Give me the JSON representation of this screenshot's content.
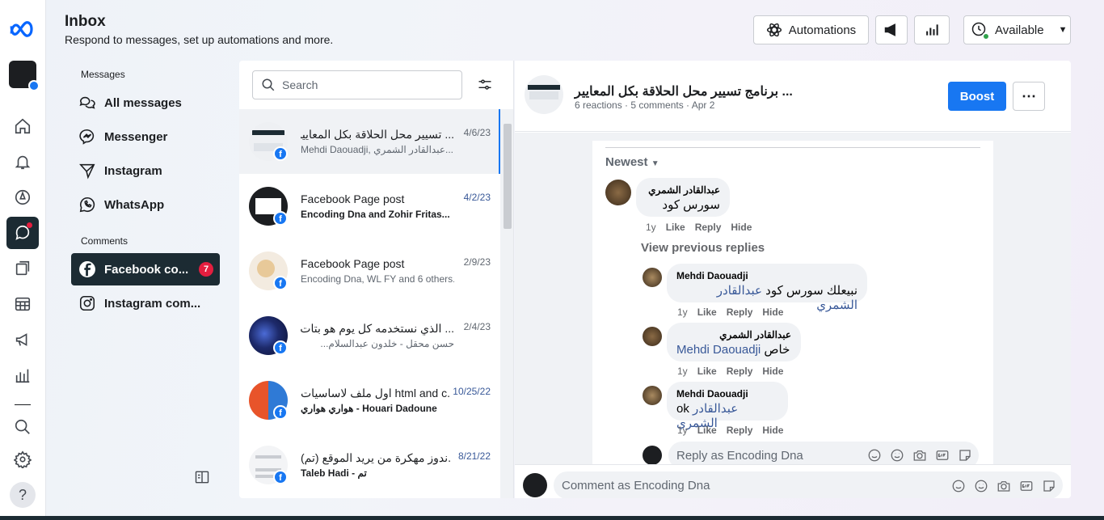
{
  "header": {
    "title": "Inbox",
    "subtitle": "Respond to messages, set up automations and more."
  },
  "top_buttons": {
    "automations": "Automations",
    "status": "Available"
  },
  "nav": {
    "messages_section": "Messages",
    "items": [
      "All messages",
      "Messenger",
      "Instagram",
      "WhatsApp"
    ],
    "comments_section": "Comments",
    "comments": [
      {
        "label": "Facebook co...",
        "badge": "7"
      },
      {
        "label": "Instagram com..."
      }
    ]
  },
  "search": {
    "placeholder": "Search"
  },
  "conversations": [
    {
      "title": "... تسيير محل الحلاقة بكل المعايير",
      "sub": "Mehdi Daouadji, عبدالقادر الشمري...",
      "date": "4/6/23"
    },
    {
      "title": "Facebook Page post",
      "sub": "Encoding Dna and Zohir Fritas...",
      "date": "4/2/23"
    },
    {
      "title": "Facebook Page post",
      "sub": "Encoding Dna, WL FY and 6 others...",
      "date": "2/9/23"
    },
    {
      "title": "... الذي نستخدمه كل يوم هو بتات",
      "sub": "حسن محقل - خلدون عبدالسلام...",
      "date": "2/4/23"
    },
    {
      "title": "اول ملف لاساسيات html and c...",
      "sub": "هواري هواري - Houari Dadoune",
      "date": "10/25/22"
    },
    {
      "title": "(تم) ندوز مهكرة من يريد الموقع...",
      "sub": "Taleb Hadi - تم",
      "date": "8/21/22"
    }
  ],
  "post": {
    "title": "... برنامج تسيير محل الحلاقة بكل المعايير",
    "meta": "6 reactions · 5 comments · Apr 2",
    "boost": "Boost",
    "sort": "Newest",
    "view_previous": "View previous replies",
    "comment": {
      "author": "عبدالقادر الشمري",
      "text": "سورس كود",
      "time": "1y"
    },
    "replies": [
      {
        "author": "Mehdi Daouadji",
        "tag": "عبدالقادر الشمري",
        "text": "نبيعلك سورس كود",
        "time": "1y"
      },
      {
        "author": "عبدالقادر الشمري",
        "tag": "Mehdi Daouadji",
        "text": "خاص",
        "time": "1y"
      },
      {
        "author": "Mehdi Daouadji",
        "tag": "عبدالقادر الشمري",
        "text": "ok",
        "time": "1y"
      }
    ],
    "actions": {
      "like": "Like",
      "reply": "Reply",
      "hide": "Hide"
    },
    "reply_placeholder": "Reply as Encoding Dna",
    "comment_placeholder": "Comment as Encoding Dna"
  }
}
